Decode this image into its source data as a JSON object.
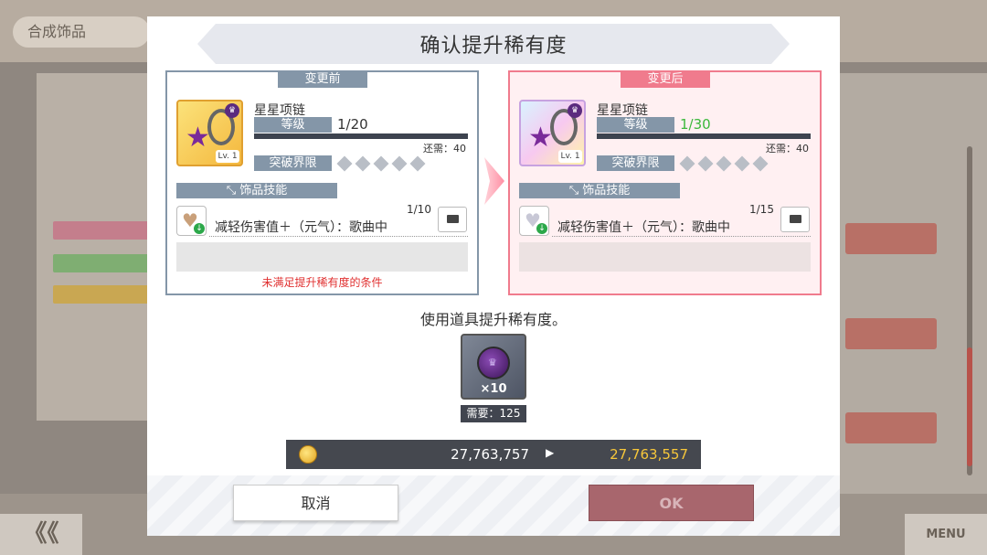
{
  "background": {
    "title": "合成饰品",
    "back_label": "《《",
    "menu_label": "MENU"
  },
  "dialog": {
    "title": "确认提升稀有度",
    "before": {
      "tag": "变更前",
      "item_name": "星星项链",
      "level_label": "等级",
      "level_value": "1/20",
      "need_exp": "还需：40",
      "limit_label": "突破界限",
      "card_level": "Lv. 1",
      "skill_header": "饰品技能",
      "skill_level": "1/10",
      "skill_text": "减轻伤害值＋（元气）：歌曲中",
      "warning": "未满足提升稀有度的条件"
    },
    "after": {
      "tag": "变更后",
      "item_name": "星星项链",
      "level_label": "等级",
      "level_value": "1/30",
      "need_exp": "还需：40",
      "limit_label": "突破界限",
      "card_level": "Lv. 1",
      "skill_header": "饰品技能",
      "skill_level": "1/15",
      "skill_text": "减轻伤害值＋（元气）：歌曲中"
    },
    "use_text": "使用道具提升稀有度。",
    "material": {
      "count": "×10",
      "need": "需要：125"
    },
    "coins": {
      "from": "27,763,757",
      "to": "27,763,557"
    },
    "cancel_label": "取消",
    "ok_label": "OK"
  },
  "colors": {
    "before_accent": "#8496a8",
    "after_accent": "#f07b8d",
    "level_after_green": "#3bb83b",
    "warning_red": "#e03030",
    "coin_gold": "#f7c73a",
    "ok_disabled": "#a8666d"
  },
  "icons": [
    "crown-icon",
    "star-necklace-icon",
    "heart-skill-icon",
    "down-arrow-icon",
    "speech-bubble-icon",
    "coin-icon",
    "rarity-orb-icon",
    "diamond-icon"
  ]
}
